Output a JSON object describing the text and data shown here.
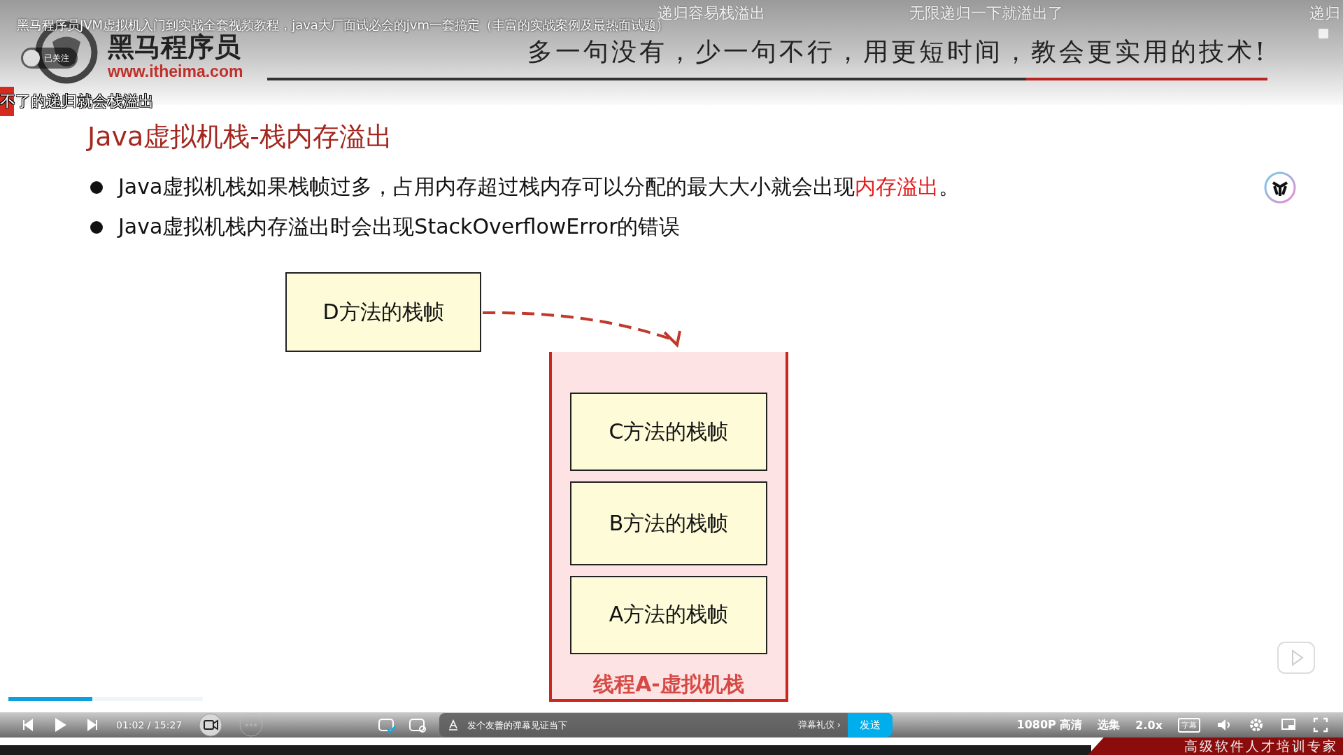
{
  "video_title": "黑马程序员JVM虚拟机入门到实战全套视频教程，java大厂面试必会的jvm一套搞定（丰富的实战案例及最热面试题）",
  "follow_badge": "已关注",
  "logo": {
    "name": "黑马程序员",
    "url": "www.itheima.com"
  },
  "slogan": "多一句没有，少一句不行，用更短时间，教会更实用的技术!",
  "danmaku": [
    {
      "text": "递归容易栈溢出",
      "marked": false
    },
    {
      "text": "无限递归一下就溢出了",
      "marked": false
    },
    {
      "text": "递归",
      "marked": false
    },
    {
      "text": "不了的递归就会栈溢出",
      "marked": true
    }
  ],
  "slide": {
    "heading": "Java虚拟机栈-栈内存溢出",
    "bullets": [
      "Java虚拟机栈如果栈帧过多，占用内存超过栈内存可以分配的最大大小就会出现**内存溢出**。",
      "Java虚拟机栈内存溢出时会出现StackOverflowError的错误"
    ]
  },
  "diagram": {
    "outside_frame": "D方法的栈帧",
    "stack_frames": [
      "C方法的栈帧",
      "B方法的栈帧",
      "A方法的栈帧"
    ],
    "stack_label": "线程A-虚拟机栈"
  },
  "mini_progress": {
    "level": 0.43
  },
  "player": {
    "time": "01:02 / 15:27",
    "danmaku_on": true,
    "placeholder": "发个友善的弹幕见证当下",
    "etiquette": "弹幕礼仪 ›",
    "send": "发送",
    "quality": "1080P 高清",
    "episodes": "选集",
    "speed": "2.0x",
    "subtitle": "字幕"
  },
  "corner_banner": "高级软件人才培训专家"
}
